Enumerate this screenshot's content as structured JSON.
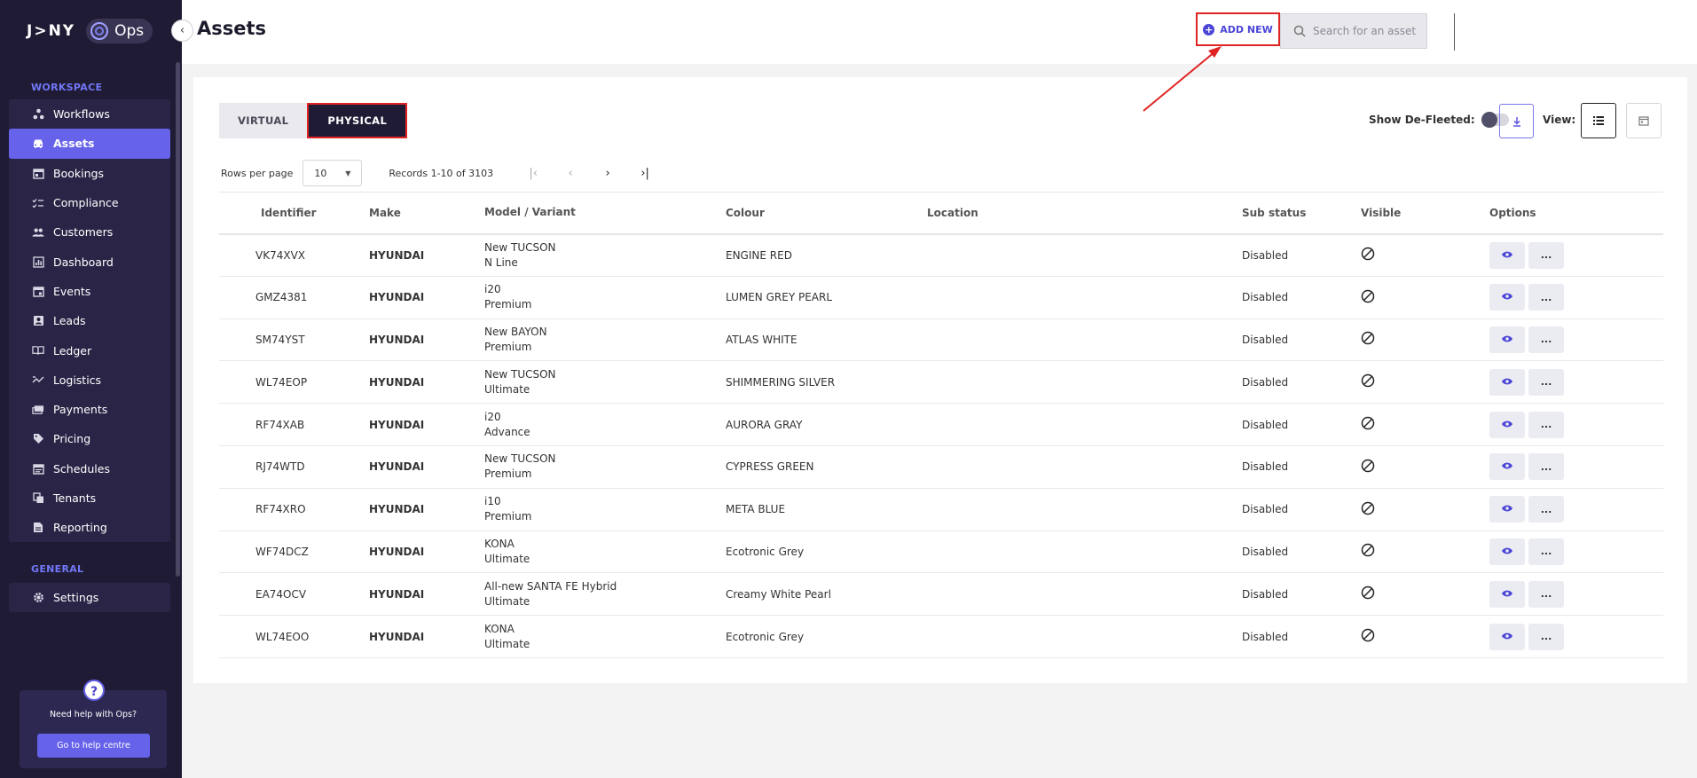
{
  "brand": {
    "word": "J>NY",
    "product": "Ops"
  },
  "sidebar": {
    "workspace_label": "WORKSPACE",
    "general_label": "GENERAL",
    "items": [
      {
        "label": "Workflows",
        "icon": "workflow-icon"
      },
      {
        "label": "Assets",
        "icon": "car-icon",
        "active": true
      },
      {
        "label": "Bookings",
        "icon": "calendar-icon"
      },
      {
        "label": "Compliance",
        "icon": "checklist-icon"
      },
      {
        "label": "Customers",
        "icon": "people-icon"
      },
      {
        "label": "Dashboard",
        "icon": "bar-chart-icon"
      },
      {
        "label": "Events",
        "icon": "event-icon"
      },
      {
        "label": "Leads",
        "icon": "contact-card-icon"
      },
      {
        "label": "Ledger",
        "icon": "book-icon"
      },
      {
        "label": "Logistics",
        "icon": "route-icon"
      },
      {
        "label": "Payments",
        "icon": "payments-icon"
      },
      {
        "label": "Pricing",
        "icon": "tag-icon"
      },
      {
        "label": "Schedules",
        "icon": "schedule-icon"
      },
      {
        "label": "Tenants",
        "icon": "tenants-icon"
      },
      {
        "label": "Reporting",
        "icon": "report-icon"
      }
    ],
    "general_items": [
      {
        "label": "Settings",
        "icon": "gear-icon"
      }
    ],
    "help": {
      "text": "Need help with Ops?",
      "button": "Go to help centre"
    }
  },
  "header": {
    "title": "Assets",
    "add_new": "ADD NEW",
    "search_placeholder": "Search for an asset"
  },
  "tabs": {
    "virtual": "VIRTUAL",
    "physical": "PHYSICAL"
  },
  "toolbar": {
    "show_defleeted": "Show De-Fleeted:",
    "view_label": "View:"
  },
  "pager": {
    "rows_per_page_label": "Rows per page",
    "rows_per_page": "10",
    "records": "Records 1-10 of 3103"
  },
  "table": {
    "headers": [
      "Identifier",
      "Make",
      "Model / Variant",
      "Colour",
      "Location",
      "Sub status",
      "Visible",
      "Options"
    ],
    "rows": [
      {
        "id": "VK74XVX",
        "make": "HYUNDAI",
        "model": "New TUCSON",
        "variant": "N Line",
        "colour": "ENGINE RED",
        "location": "",
        "status": "Disabled"
      },
      {
        "id": "GMZ4381",
        "make": "HYUNDAI",
        "model": "i20",
        "variant": "Premium",
        "colour": "LUMEN GREY PEARL",
        "location": "",
        "status": "Disabled"
      },
      {
        "id": "SM74YST",
        "make": "HYUNDAI",
        "model": "New BAYON",
        "variant": "Premium",
        "colour": "ATLAS WHITE",
        "location": "",
        "status": "Disabled"
      },
      {
        "id": "WL74EOP",
        "make": "HYUNDAI",
        "model": "New TUCSON",
        "variant": "Ultimate",
        "colour": "SHIMMERING SILVER",
        "location": "",
        "status": "Disabled"
      },
      {
        "id": "RF74XAB",
        "make": "HYUNDAI",
        "model": "i20",
        "variant": "Advance",
        "colour": "AURORA GRAY",
        "location": "",
        "status": "Disabled"
      },
      {
        "id": "RJ74WTD",
        "make": "HYUNDAI",
        "model": "New TUCSON",
        "variant": "Premium",
        "colour": "CYPRESS GREEN",
        "location": "",
        "status": "Disabled"
      },
      {
        "id": "RF74XRO",
        "make": "HYUNDAI",
        "model": "i10",
        "variant": "Premium",
        "colour": "META BLUE",
        "location": "",
        "status": "Disabled"
      },
      {
        "id": "WF74DCZ",
        "make": "HYUNDAI",
        "model": "KONA",
        "variant": "Ultimate",
        "colour": "Ecotronic Grey",
        "location": "",
        "status": "Disabled"
      },
      {
        "id": "EA74OCV",
        "make": "HYUNDAI",
        "model": "All-new SANTA FE Hybrid",
        "variant": "Ultimate",
        "colour": "Creamy White Pearl",
        "location": "",
        "status": "Disabled"
      },
      {
        "id": "WL74EOO",
        "make": "HYUNDAI",
        "model": "KONA",
        "variant": "Ultimate",
        "colour": "Ecotronic Grey",
        "location": "",
        "status": "Disabled"
      }
    ],
    "more_label": "..."
  },
  "colors": {
    "sidebar_bg": "#201b35",
    "accent": "#6662ea",
    "annotation_red": "#e02424"
  }
}
